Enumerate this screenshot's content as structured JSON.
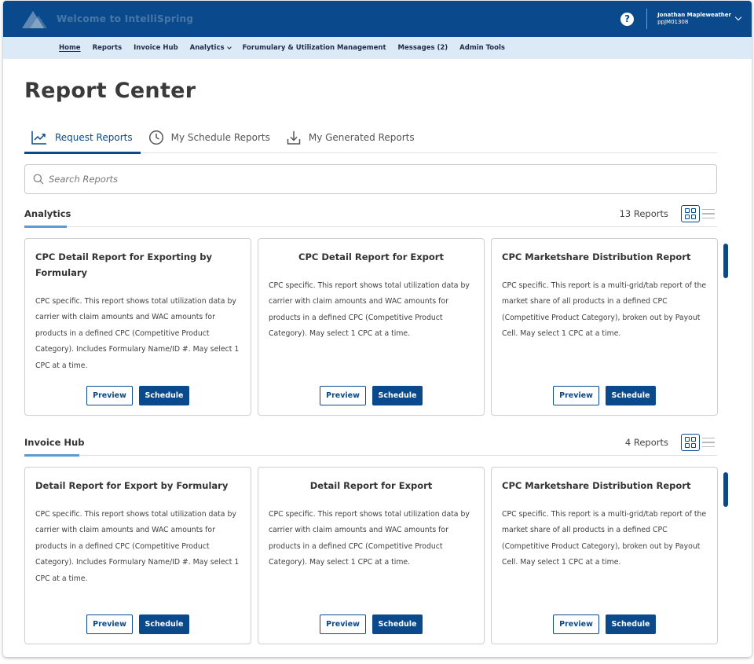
{
  "header": {
    "welcome": "Welcome to IntelliSpring",
    "user_name": "Jonathan Mapleweather",
    "user_id": "ppJM01308",
    "help_glyph": "?",
    "brand_color": "#0a4a8c"
  },
  "nav": {
    "home": "Home",
    "reports": "Reports",
    "invoice_hub": "Invoice Hub",
    "analytics": "Analytics",
    "formulary": "Forumulary & Utilization Management",
    "messages": "Messages (2)",
    "admin": "Admin Tools"
  },
  "page": {
    "title": "Report Center"
  },
  "tabs": {
    "request": "Request Reports",
    "schedule": "My Schedule Reports",
    "generated": "My Generated Reports"
  },
  "search": {
    "placeholder": "Search Reports"
  },
  "sections": {
    "analytics": {
      "title": "Analytics",
      "count": "13 Reports",
      "cards": [
        {
          "title": "CPC Detail Report for Exporting by Formulary",
          "description": "CPC specific. This report shows total utilization data by carrier with claim amounts and WAC amounts for products in a defined CPC (Competitive Product Category). Includes Formulary Name/ID #. May select 1 CPC at a time.",
          "preview": "Preview",
          "schedule": "Schedule"
        },
        {
          "title": "CPC Detail Report for Export",
          "description": "CPC specific. This report shows total utilization data by carrier with claim amounts and WAC amounts for products in a defined CPC (Competitive Product Category). May select 1 CPC at a time.",
          "preview": "Preview",
          "schedule": "Schedule"
        },
        {
          "title": "CPC Marketshare Distribution Report",
          "description": "CPC specific. This report is a multi-grid/tab report of the market share of all products in a defined CPC (Competitive Product Category), broken out by Payout Cell. May select 1 CPC at a time.",
          "preview": "Preview",
          "schedule": "Schedule"
        }
      ]
    },
    "invoice_hub": {
      "title": "Invoice Hub",
      "count": "4 Reports",
      "cards": [
        {
          "title": "Detail Report for Export by Formulary",
          "description": "CPC specific. This report shows total utilization data by carrier with claim amounts and WAC amounts for products in a defined CPC (Competitive Product Category). Includes Formulary Name/ID #. May select 1 CPC at a time.",
          "preview": "Preview",
          "schedule": "Schedule"
        },
        {
          "title": "Detail Report for Export",
          "description": "CPC specific. This report shows total utilization data by carrier with claim amounts and WAC amounts for products in a defined CPC (Competitive Product Category). May select 1 CPC at a time.",
          "preview": "Preview",
          "schedule": "Schedule"
        },
        {
          "title": "CPC Marketshare Distribution Report",
          "description": "CPC specific. This report is a multi-grid/tab report of the market share of all products in a defined CPC (Competitive Product Category), broken out by Payout Cell. May select 1 CPC at a time.",
          "preview": "Preview",
          "schedule": "Schedule"
        }
      ]
    }
  }
}
